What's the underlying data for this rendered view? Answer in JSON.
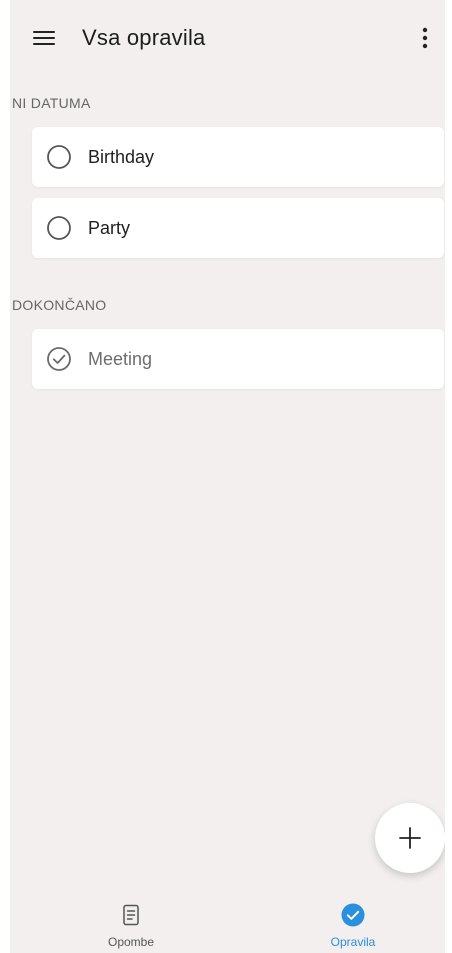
{
  "header": {
    "title": "Vsa opravila",
    "menu_icon": "hamburger-menu-icon",
    "more_icon": "more-vert-icon"
  },
  "sections": [
    {
      "label": "NI DATUMA",
      "items": [
        {
          "label": "Birthday",
          "completed": false
        },
        {
          "label": "Party",
          "completed": false
        }
      ]
    },
    {
      "label": "DOKONČANO",
      "items": [
        {
          "label": "Meeting",
          "completed": true
        }
      ]
    }
  ],
  "fab": {
    "icon": "plus-icon"
  },
  "bottom_nav": {
    "items": [
      {
        "label": "Opombe",
        "icon": "notes-icon",
        "active": false
      },
      {
        "label": "Opravila",
        "icon": "check-circle-icon",
        "active": true
      }
    ]
  },
  "colors": {
    "background": "#f2efee",
    "accent": "#2a8fdc",
    "card": "#ffffff",
    "text": "#1d1d1d"
  }
}
